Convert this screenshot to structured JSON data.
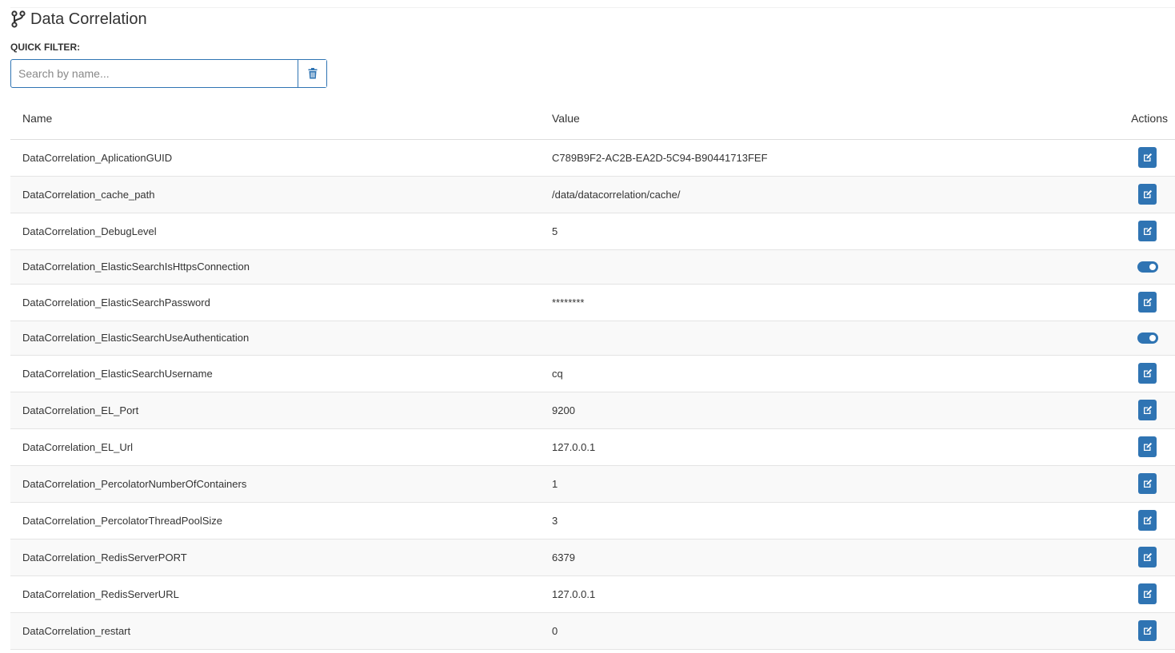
{
  "page": {
    "title": "Data Correlation",
    "title_icon": "code-branch-icon"
  },
  "filter": {
    "label": "QUICK FILTER:",
    "placeholder": "Search by name...",
    "value": "",
    "clear_icon": "trash-icon"
  },
  "table": {
    "columns": [
      "Name",
      "Value",
      "Actions"
    ],
    "rows": [
      {
        "name": "DataCorrelation_AplicationGUID",
        "value": "C789B9F2-AC2B-EA2D-5C94-B90441713FEF",
        "action": "edit"
      },
      {
        "name": "DataCorrelation_cache_path",
        "value": "/data/datacorrelation/cache/",
        "action": "edit"
      },
      {
        "name": "DataCorrelation_DebugLevel",
        "value": "5",
        "action": "edit"
      },
      {
        "name": "DataCorrelation_ElasticSearchIsHttpsConnection",
        "value": "",
        "action": "toggle",
        "toggle_on": true
      },
      {
        "name": "DataCorrelation_ElasticSearchPassword",
        "value": "********",
        "action": "edit"
      },
      {
        "name": "DataCorrelation_ElasticSearchUseAuthentication",
        "value": "",
        "action": "toggle",
        "toggle_on": true
      },
      {
        "name": "DataCorrelation_ElasticSearchUsername",
        "value": "cq",
        "action": "edit"
      },
      {
        "name": "DataCorrelation_EL_Port",
        "value": "9200",
        "action": "edit"
      },
      {
        "name": "DataCorrelation_EL_Url",
        "value": "127.0.0.1",
        "action": "edit"
      },
      {
        "name": "DataCorrelation_PercolatorNumberOfContainers",
        "value": "1",
        "action": "edit"
      },
      {
        "name": "DataCorrelation_PercolatorThreadPoolSize",
        "value": "3",
        "action": "edit"
      },
      {
        "name": "DataCorrelation_RedisServerPORT",
        "value": "6379",
        "action": "edit"
      },
      {
        "name": "DataCorrelation_RedisServerURL",
        "value": "127.0.0.1",
        "action": "edit"
      },
      {
        "name": "DataCorrelation_restart",
        "value": "0",
        "action": "edit"
      }
    ]
  },
  "colors": {
    "accent": "#2f74b3",
    "text": "#333333",
    "row_stripe": "#f9f9f9",
    "border": "#dddddd"
  }
}
